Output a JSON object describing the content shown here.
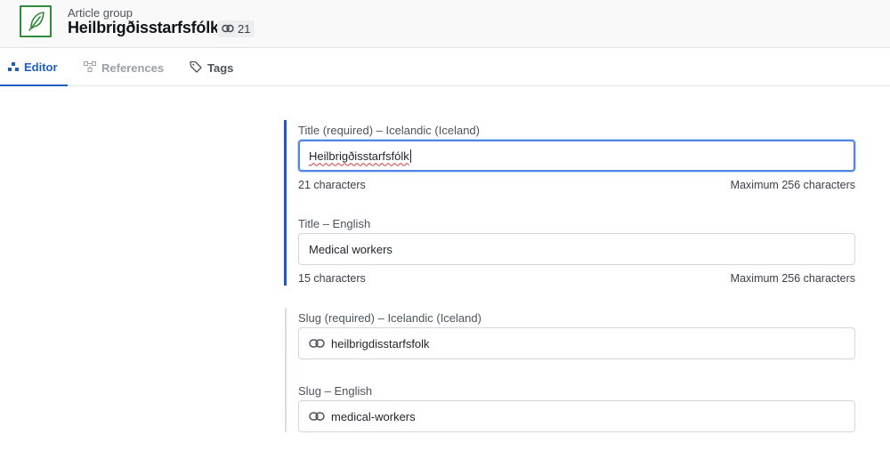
{
  "header": {
    "breadcrumb": "Article group",
    "title": "Heilbrigðisstarfsfólk",
    "reference_count": "21",
    "icon": "feather-icon",
    "accent": "#2f8a3c"
  },
  "tabs": [
    {
      "label": "Editor",
      "icon": "tree-icon",
      "active": true
    },
    {
      "label": "References",
      "icon": "graph-icon",
      "active": false
    },
    {
      "label": "Tags",
      "icon": "tag-icon",
      "active": false
    }
  ],
  "fields": {
    "title_is": {
      "label": "Title (required) – Icelandic (Iceland)",
      "value": "Heilbrigðisstarfsfólk",
      "count": "21 characters",
      "max": "Maximum 256 characters"
    },
    "title_en": {
      "label": "Title – English",
      "value": "Medical workers",
      "count": "15 characters",
      "max": "Maximum 256 characters"
    },
    "slug_is": {
      "label": "Slug (required) – Icelandic (Iceland)",
      "value": "heilbrigdisstarfsfolk",
      "icon": "link-icon"
    },
    "slug_en": {
      "label": "Slug – English",
      "value": "medical-workers",
      "icon": "link-icon"
    }
  },
  "colors": {
    "active_tab": "#1f5cbf",
    "active_group_bar": "#2156c7",
    "focus_border": "#4f86e6"
  }
}
